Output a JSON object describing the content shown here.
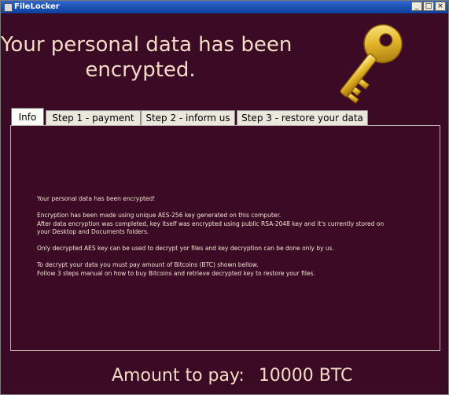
{
  "window": {
    "title": "FileLocker",
    "controls": {
      "minimize": "_",
      "maximize": "□",
      "close": "×"
    }
  },
  "header": {
    "headline_line1": "Your personal data has been",
    "headline_line2": "encrypted.",
    "icon": "key-icon"
  },
  "tabs": [
    {
      "label": "Info",
      "active": true
    },
    {
      "label": "Step 1 - payment",
      "active": false
    },
    {
      "label": "Step 2 - inform us",
      "active": false
    },
    {
      "label": "Step 3 - restore your data",
      "active": false
    }
  ],
  "info": {
    "paragraphs": [
      [
        "Your personal data has been encrypted!"
      ],
      [
        "Encryption has been made using unique AES-256 key generated on this computer.",
        "After data encryption was completed, key itself was encrypted using public RSA-2048 key and it's currently stored on",
        "your Desktop and Documents folders."
      ],
      [
        "Only decrypted AES key can be used to decrypt yor files and key decryption can be done only by us."
      ],
      [
        "To decrypt your data you must pay amount of Bitcoins (BTC) shown bellow.",
        "Follow 3 steps manual on how to buy Bitcoins and retrieve decrypted key to restore your files."
      ]
    ]
  },
  "footer": {
    "amount_label": "Amount to pay:",
    "amount_value": "10000 BTC"
  },
  "colors": {
    "background": "#3b0a24",
    "headline_text": "#f2dcc6",
    "body_text": "#f3e4d4",
    "key_gold": "#e6b92c"
  }
}
